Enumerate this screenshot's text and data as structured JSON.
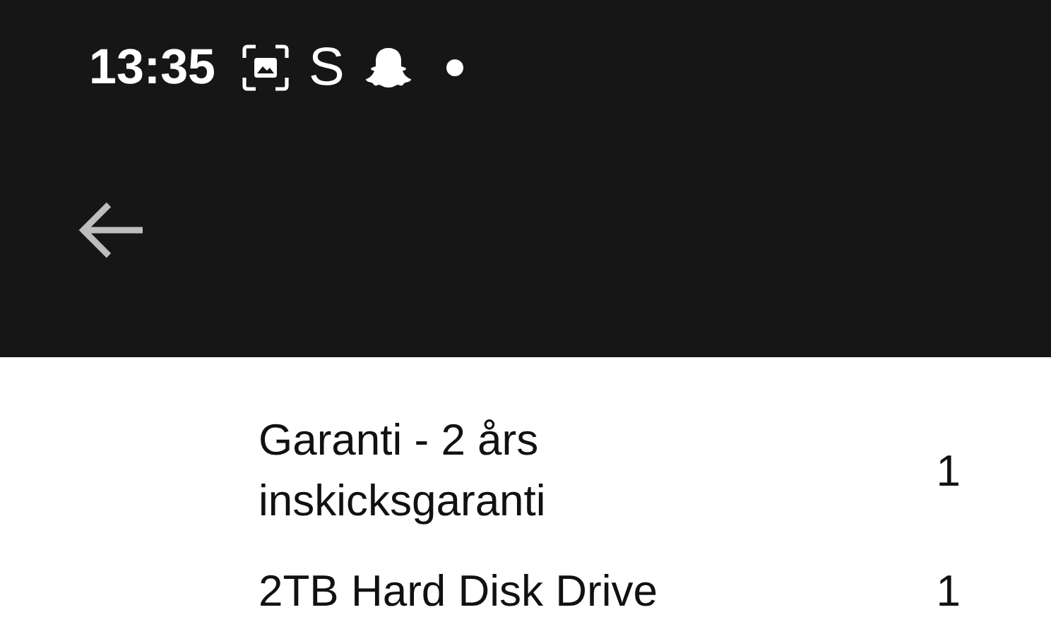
{
  "status_bar": {
    "time": "13:35",
    "letter_icon": "S"
  },
  "items": [
    {
      "name": "Garanti - 2 års inskicksgaranti",
      "quantity": "1"
    },
    {
      "name": "2TB Hard Disk Drive",
      "quantity": "1"
    }
  ]
}
